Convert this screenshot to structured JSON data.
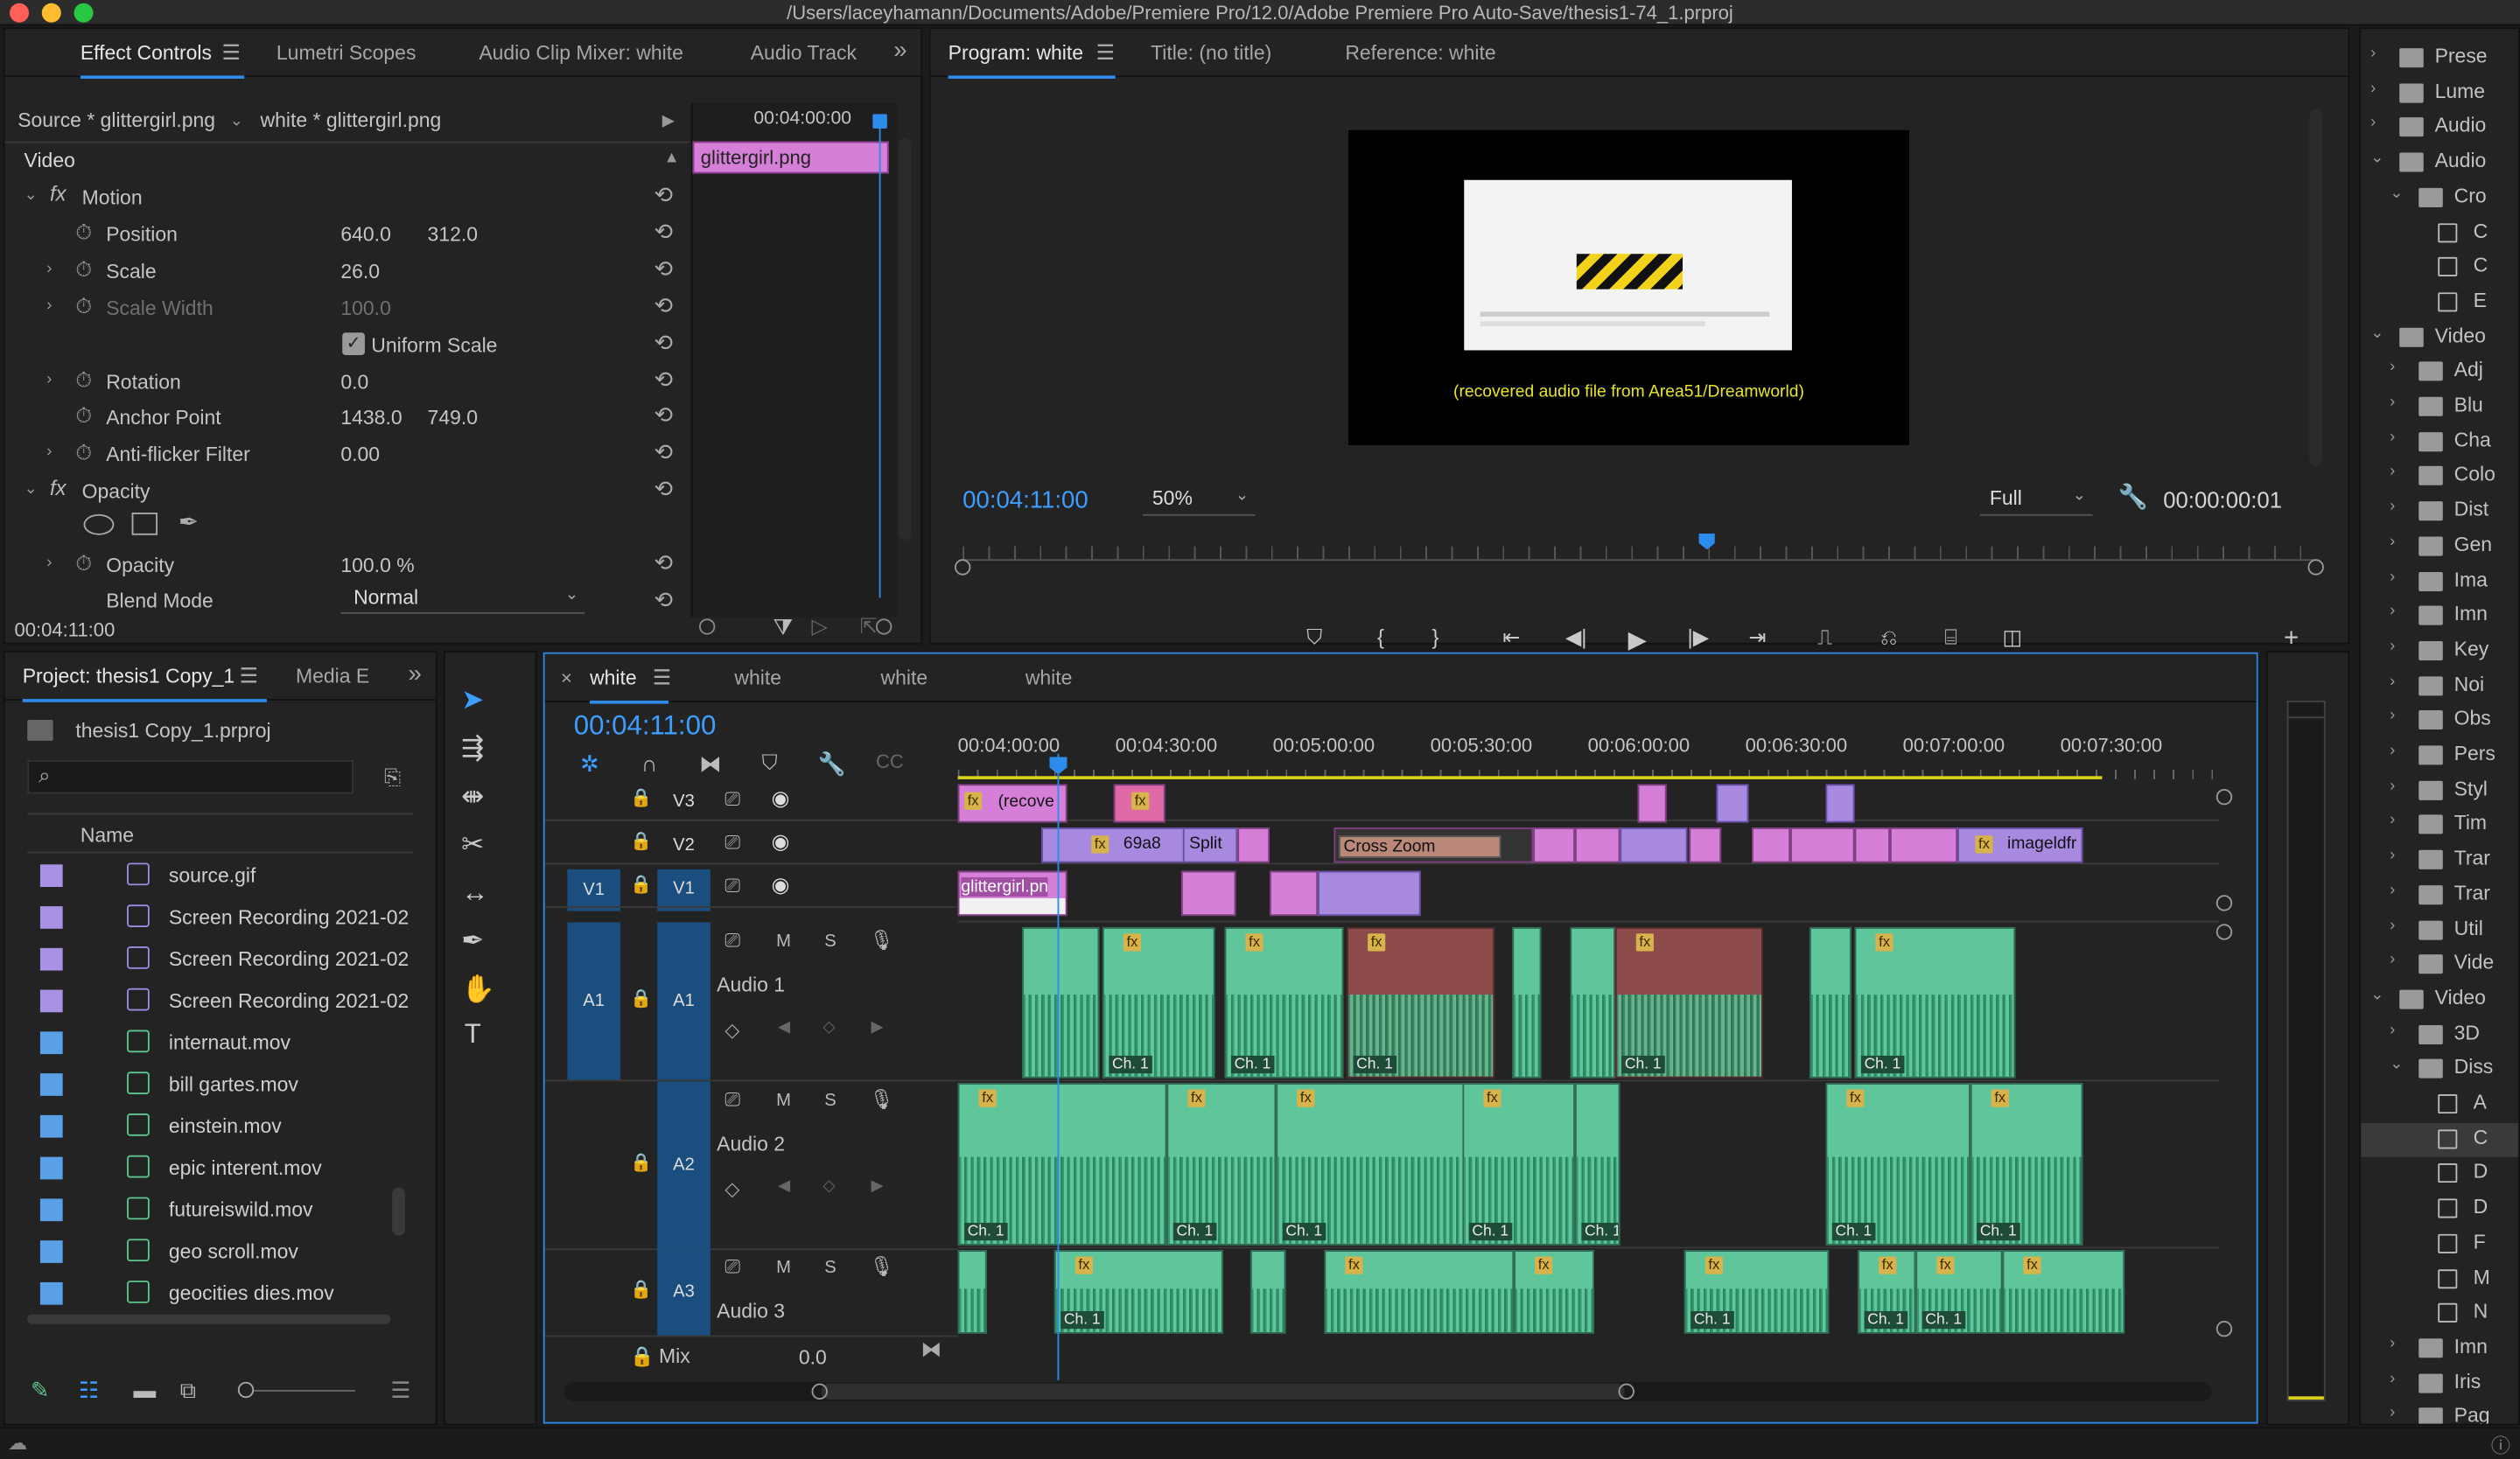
{
  "window": {
    "title": "/Users/laceyhamann/Documents/Adobe/Premiere Pro/12.0/Adobe Premiere Pro Auto-Save/thesis1-74_1.prproj"
  },
  "effect_controls": {
    "tabs": [
      "Effect Controls",
      "Lumetri Scopes",
      "Audio Clip Mixer: white",
      "Audio Track"
    ],
    "source": "Source * glittergirl.png",
    "sequence": "white * glittergirl.png",
    "mini_timecode": "00:04:00:00",
    "mini_clip": "glittergirl.png",
    "section": "Video",
    "motion": "Motion",
    "position_label": "Position",
    "position_x": "640.0",
    "position_y": "312.0",
    "scale_label": "Scale",
    "scale": "26.0",
    "scale_width_label": "Scale Width",
    "scale_width": "100.0",
    "uniform_scale": "Uniform Scale",
    "rotation_label": "Rotation",
    "rotation": "0.0",
    "anchor_label": "Anchor Point",
    "anchor_x": "1438.0",
    "anchor_y": "749.0",
    "antiflicker_label": "Anti-flicker Filter",
    "antiflicker": "0.00",
    "opacity_section": "Opacity",
    "opacity_label": "Opacity",
    "opacity": "100.0 %",
    "blend_label": "Blend Mode",
    "blend": "Normal",
    "timecode": "00:04:11:00"
  },
  "program": {
    "tabs": [
      "Program: white",
      "Title: (no title)",
      "Reference: white"
    ],
    "caption": "(recovered audio file from Area51/Dreamworld)",
    "timecode": "00:04:11:00",
    "zoom": "50%",
    "quality": "Full",
    "duration": "00:00:00:01",
    "playhead_fraction": 0.55
  },
  "project": {
    "tabs": [
      "Project: thesis1 Copy_1",
      "Media E"
    ],
    "file": "thesis1 Copy_1.prproj",
    "column": "Name",
    "items": [
      {
        "name": "source.gif",
        "type": "img",
        "color": "#a991e6"
      },
      {
        "name": "Screen Recording 2021-02",
        "type": "img",
        "color": "#a991e6"
      },
      {
        "name": "Screen Recording 2021-02",
        "type": "img",
        "color": "#a991e6"
      },
      {
        "name": "Screen Recording 2021-02",
        "type": "img",
        "color": "#a991e6"
      },
      {
        "name": "internaut.mov",
        "type": "mov",
        "color": "#5aa0e6"
      },
      {
        "name": "bill gartes.mov",
        "type": "mov",
        "color": "#5aa0e6"
      },
      {
        "name": "einstein.mov",
        "type": "mov",
        "color": "#5aa0e6"
      },
      {
        "name": "epic interent.mov",
        "type": "mov",
        "color": "#5aa0e6"
      },
      {
        "name": "futureiswild.mov",
        "type": "mov",
        "color": "#5aa0e6"
      },
      {
        "name": "geo scroll.mov",
        "type": "mov",
        "color": "#5aa0e6"
      },
      {
        "name": "geocities dies.mov",
        "type": "mov",
        "color": "#5aa0e6"
      }
    ]
  },
  "timeline": {
    "tabs": [
      "white",
      "white",
      "white",
      "white"
    ],
    "timecode": "00:04:11:00",
    "ruler": [
      "00:04:00:00",
      "00:04:30:00",
      "00:05:00:00",
      "00:05:30:00",
      "00:06:00:00",
      "00:06:30:00",
      "00:07:00:00",
      "00:07:30:00"
    ],
    "v_tracks": [
      "V3",
      "V2",
      "V1"
    ],
    "v1_source": "V1",
    "a_tracks": [
      {
        "id": "A1",
        "name": "Audio 1",
        "src": "A1"
      },
      {
        "id": "A2",
        "name": "Audio 2"
      },
      {
        "id": "A3",
        "name": "Audio 3"
      }
    ],
    "mix_label": "Mix",
    "mix_value": "0.0",
    "track_letters": {
      "m": "M",
      "s": "S"
    },
    "clip_labels": {
      "v3": "(recove",
      "v2a": "69a8",
      "v2b": "Split",
      "v2c": "Cross Zoom",
      "v2d": "imageldfr",
      "v1": "glittergirl.pn",
      "fx": "fx",
      "ch": "Ch. 1"
    }
  },
  "effects_tree": {
    "items": [
      "Prese",
      "Lume",
      "Audio",
      "Audio",
      "Cro",
      "C",
      "C",
      "E",
      "Video",
      "Adj",
      "Blu",
      "Cha",
      "Colo",
      "Dist",
      "Gen",
      "Ima",
      "Imn",
      "Key",
      "Noi",
      "Obs",
      "Pers",
      "Styl",
      "Tim",
      "Trar",
      "Trar",
      "Util",
      "Vide",
      "Video",
      "3D",
      "Diss",
      "A",
      "C",
      "D",
      "D",
      "F",
      "M",
      "N",
      "Imn",
      "Iris",
      "Pag"
    ]
  },
  "colors": {
    "accent": "#2d8ceb",
    "timecode_blue": "#3e9eff",
    "video_clip": "#d57fd8",
    "audio_clip": "#5ec69a",
    "track_blue": "#1a4e7e"
  }
}
